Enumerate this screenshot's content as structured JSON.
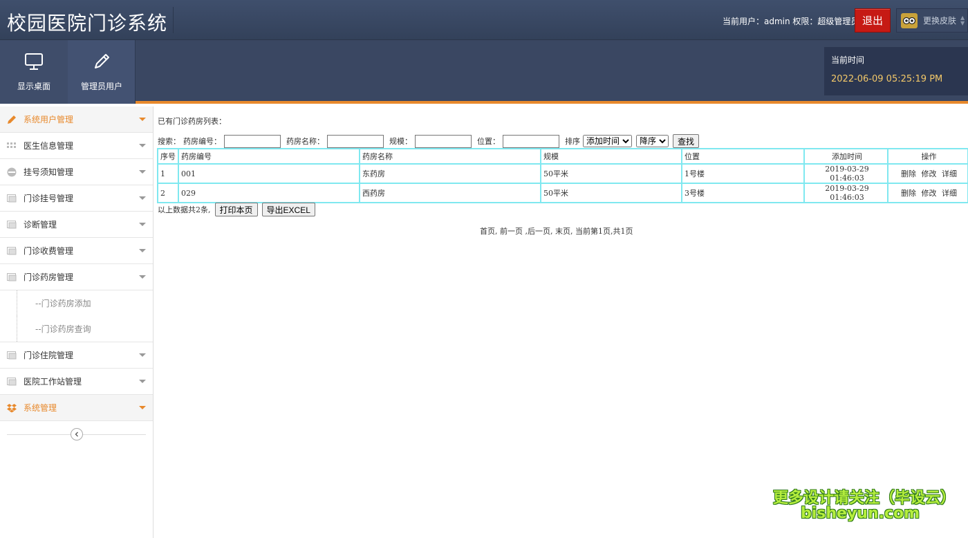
{
  "header": {
    "title": "校园医院门诊系统",
    "user_info": "当前用户：admin 权限：超级管理员",
    "logout_label": "退出",
    "skin_label": "更换皮肤"
  },
  "toolbar": {
    "desktop_label": "显示桌面",
    "admin_label": "管理员用户",
    "time_label": "当前时间",
    "time_value": "2022-06-09 05:25:19 PM"
  },
  "sidebar": {
    "items": [
      {
        "label": "系统用户管理",
        "icon": "pencil-icon"
      },
      {
        "label": "医生信息管理",
        "icon": "grid-icon"
      },
      {
        "label": "挂号须知管理",
        "icon": "minus-circle-icon"
      },
      {
        "label": "门诊挂号管理",
        "icon": "window-icon"
      },
      {
        "label": "诊断管理",
        "icon": "window-icon"
      },
      {
        "label": "门诊收费管理",
        "icon": "window-icon"
      },
      {
        "label": "门诊药房管理",
        "icon": "window-icon"
      },
      {
        "label": "门诊住院管理",
        "icon": "window-icon"
      },
      {
        "label": "医院工作站管理",
        "icon": "window-icon"
      },
      {
        "label": "系统管理",
        "icon": "dropbox-icon"
      }
    ],
    "sub_items": [
      "--门诊药房添加",
      "--门诊药房查询"
    ]
  },
  "content": {
    "list_title": "已有门诊药房列表：",
    "search": {
      "prefix": "搜索：",
      "code_label": "药房编号：",
      "name_label": "药房名称：",
      "scale_label": "规模：",
      "location_label": "位置：",
      "sort_label": "排序",
      "sort_field": "添加时间",
      "sort_order": "降序",
      "search_button": "查找"
    },
    "table": {
      "columns": [
        "序号",
        "药房编号",
        "药房名称",
        "规模",
        "位置",
        "添加时间",
        "操作"
      ],
      "rows": [
        {
          "index": "1",
          "code": "001",
          "name": "东药房",
          "scale": "50平米",
          "location": "1号楼",
          "time": "2019-03-29 01:46:03"
        },
        {
          "index": "2",
          "code": "029",
          "name": "西药房",
          "scale": "50平米",
          "location": "3号楼",
          "time": "2019-03-29 01:46:03"
        }
      ],
      "actions": {
        "delete": "删除",
        "edit": "修改",
        "detail": "详细"
      }
    },
    "summary": "以上数据共2条,",
    "print_button": "打印本页",
    "export_button": "导出EXCEL",
    "pager": "首页, 前一页 ,后一页, 末页, 当前第1页,共1页"
  },
  "watermark": {
    "line1": "更多设计请关注（毕设云）",
    "line2": "bisheyun.com"
  },
  "colors": {
    "header_bg": "#3a4762",
    "accent": "#e8892c",
    "logout_bg": "#c61a14",
    "table_border": "#7fe8f0",
    "time_value": "#f4c969"
  }
}
